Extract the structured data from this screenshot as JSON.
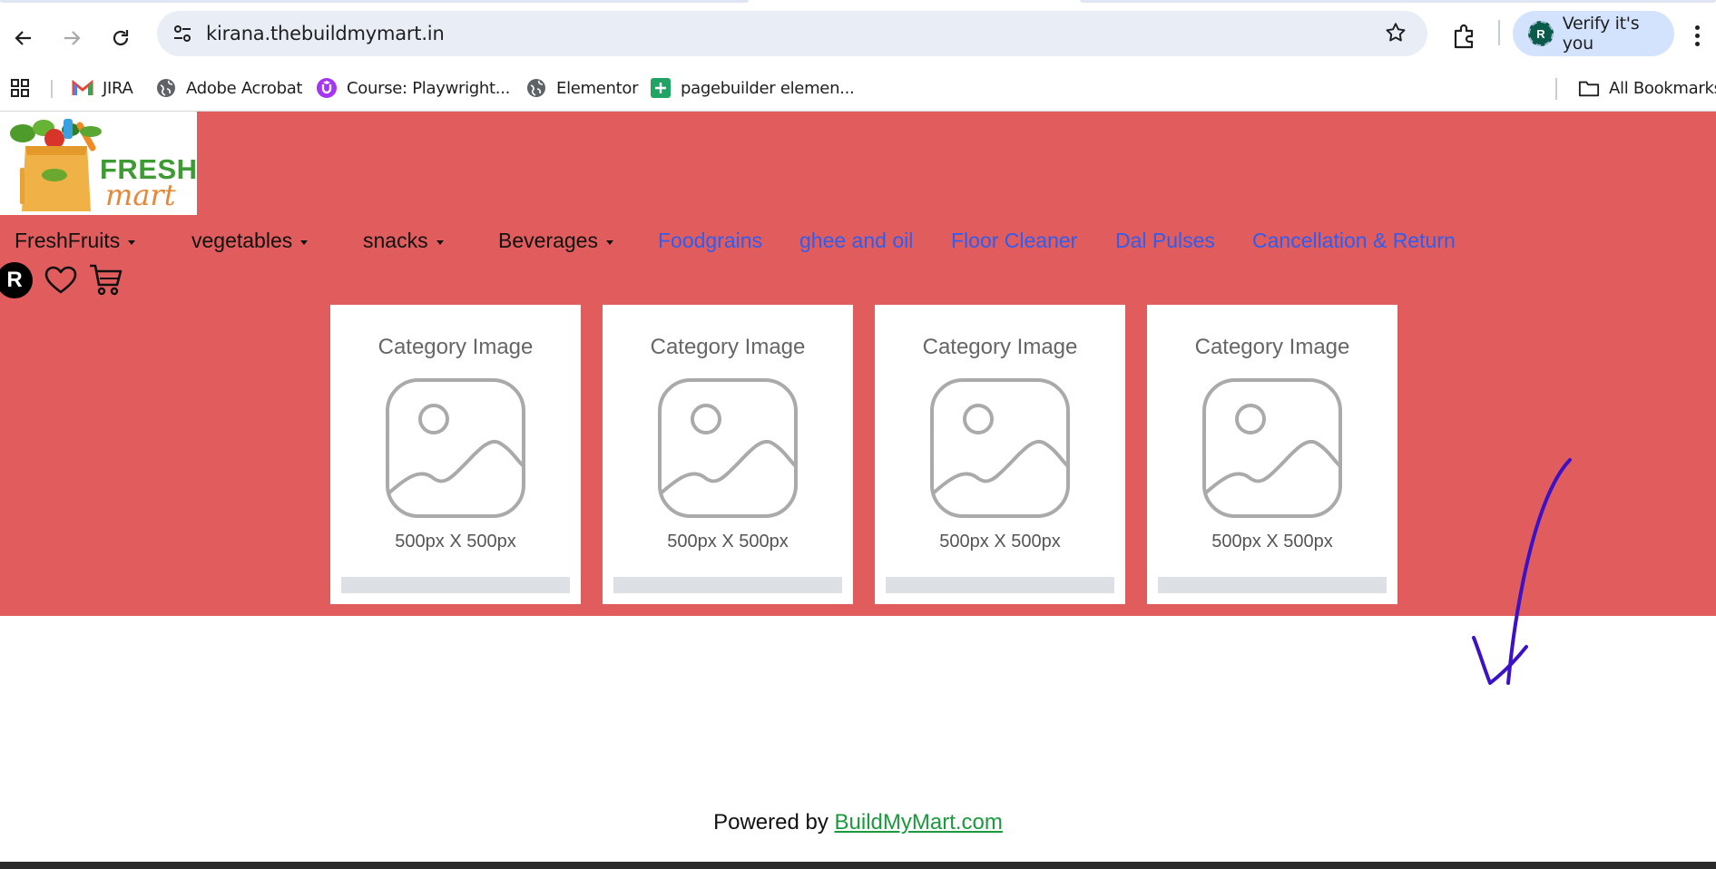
{
  "browser": {
    "url": "kirana.thebuildmymart.in",
    "profile_initial": "R",
    "profile_chip_label": "Verify it's you",
    "icons": [
      "back-arrow-icon",
      "forward-arrow-icon",
      "reload-icon",
      "site-settings-icon",
      "bookmark-star-icon",
      "extensions-icon",
      "more-menu-icon"
    ]
  },
  "bookmarks": {
    "items": [
      {
        "label": "JIRA",
        "icon": "gmail-icon"
      },
      {
        "label": "Adobe Acrobat",
        "icon": "globe-icon"
      },
      {
        "label": "Course: Playwright...",
        "icon": "udemy-icon"
      },
      {
        "label": "Elementor",
        "icon": "globe-icon"
      },
      {
        "label": "pagebuilder elemen...",
        "icon": "sheets-icon"
      }
    ],
    "all_bookmarks_label": "All Bookmarks"
  },
  "site": {
    "logo_text": [
      "FRESH",
      "mart"
    ],
    "header_color": "#e05c5d",
    "nav": {
      "dropdowns": [
        "FreshFruits",
        "vegetables",
        "snacks",
        "Beverages"
      ],
      "links": [
        "Foodgrains",
        "ghee and oil",
        "Floor Cleaner",
        "Dal Pulses",
        "Cancellation & Return"
      ]
    },
    "user_initial": "R",
    "category_cards": [
      {
        "title": "Category Image",
        "size": "500px X 500px"
      },
      {
        "title": "Category Image",
        "size": "500px X 500px"
      },
      {
        "title": "Category Image",
        "size": "500px X 500px"
      },
      {
        "title": "Category Image",
        "size": "500px X 500px"
      }
    ],
    "footer": {
      "prefix": "Powered by ",
      "link": "BuildMyMart.com",
      "link_color": "#1a9a3c"
    }
  }
}
